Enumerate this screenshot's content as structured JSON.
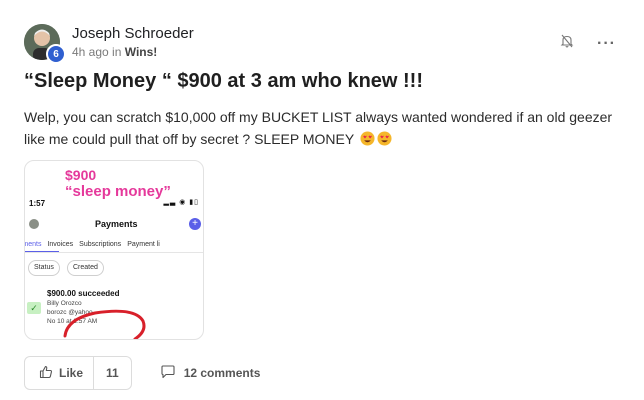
{
  "post": {
    "author": "Joseph Schroeder",
    "level": "6",
    "time": "4h ago in ",
    "category": "Wins!",
    "title": "“Sleep Money “ $900 at 3 am who knew !!!",
    "body": "Welp, you can scratch $10,000 off my BUCKET LIST always wanted wondered if an old geezer like me could pull that off by secret ? SLEEP MONEY",
    "icons": {
      "notify": "bell-off-icon",
      "more": "more-dots-icon",
      "emoji": "heart-eyes-emoji"
    }
  },
  "image": {
    "overlay_line1": "$900",
    "overlay_line2": "“sleep money”",
    "phone_time": "1:57",
    "page_title": "Payments",
    "tabs": [
      "ayments",
      "Invoices",
      "Subscriptions",
      "Payment li"
    ],
    "chips": [
      "Status",
      "Created"
    ],
    "amount": "$900.00 succeeded",
    "name": "Billy Orozco",
    "email": "borozc     @yahoo",
    "date": "No   10 at 2:57 AM"
  },
  "actions": {
    "like_label": "Like",
    "like_count": "11",
    "comments": "12 comments"
  }
}
